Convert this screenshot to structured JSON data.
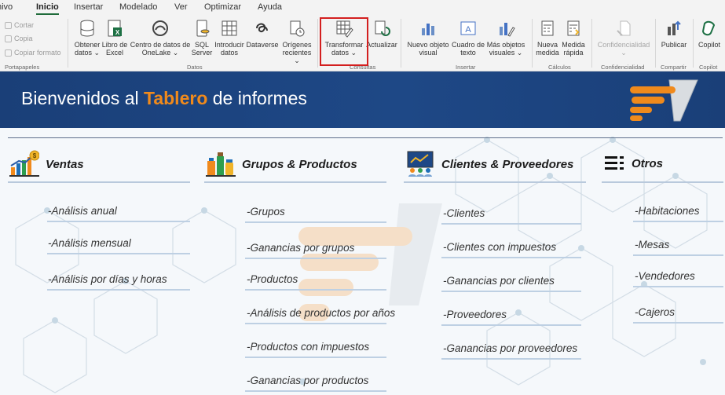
{
  "menu": {
    "tabs": [
      {
        "label": "hivo"
      },
      {
        "label": "Inicio",
        "active": true
      },
      {
        "label": "Insertar"
      },
      {
        "label": "Modelado"
      },
      {
        "label": "Ver"
      },
      {
        "label": "Optimizar"
      },
      {
        "label": "Ayuda"
      }
    ]
  },
  "ribbon": {
    "clipboard": {
      "cut": "Cortar",
      "copy": "Copia",
      "format": "Copiar formato",
      "group": "Portapapeles"
    },
    "data": {
      "get_data": "Obtener\ndatos ⌄",
      "excel": "Libro de\nExcel",
      "onelake": "Centro de datos de\nOneLake ⌄",
      "sql": "SQL\nServer",
      "enter_data": "Introducir\ndatos",
      "dataverse": "Dataverse",
      "recent": "Orígenes\nrecientes ⌄",
      "group": "Datos"
    },
    "queries": {
      "transform": "Transformar\ndatos ⌄",
      "refresh": "Actualizar",
      "group": "Consultas"
    },
    "insert": {
      "new_visual": "Nuevo objeto\nvisual",
      "textbox": "Cuadro de\ntexto",
      "more_visuals": "Más objetos\nvisuales ⌄",
      "group": "Insertar"
    },
    "calculations": {
      "new_measure": "Nueva\nmedida",
      "quick_measure": "Medida\nrápida",
      "group": "Cálculos"
    },
    "sensitivity": {
      "label": "Confidencialidad\n⌄",
      "group": "Confidencialidad"
    },
    "share": {
      "publish": "Publicar",
      "group": "Compartir"
    },
    "copilot": {
      "label": "Copilot",
      "group": "Copilot"
    }
  },
  "banner": {
    "prefix": "Bienvenidos al ",
    "highlight": "Tablero",
    "suffix": " de informes"
  },
  "colors": {
    "banner": "#1e4886",
    "highlight": "#f08a1c",
    "selection_box": "#d31f1f"
  },
  "categories": [
    {
      "key": "ventas",
      "title": "Ventas",
      "icon": "sales-chart-icon",
      "links": [
        "-Análisis anual",
        "-Análisis mensual",
        "-Análisis por días y horas"
      ]
    },
    {
      "key": "grupos",
      "title": "Grupos & Productos",
      "icon": "products-icon",
      "links": [
        "-Grupos",
        "-Ganancias por grupos",
        "-Productos",
        "-Análisis de productos por años",
        "-Productos con impuestos",
        "-Ganancias por productos"
      ]
    },
    {
      "key": "clientes",
      "title": "Clientes & Proveedores",
      "icon": "clients-presentation-icon",
      "links": [
        "-Clientes",
        "-Clientes con impuestos",
        "-Ganancias por clientes",
        "-Proveedores",
        "-Ganancias por proveedores"
      ]
    },
    {
      "key": "otros",
      "title": "Otros",
      "icon": "list-icon",
      "links": [
        "-Habitaciones",
        "-Mesas",
        "-Vendedores",
        "-Cajeros"
      ]
    }
  ]
}
